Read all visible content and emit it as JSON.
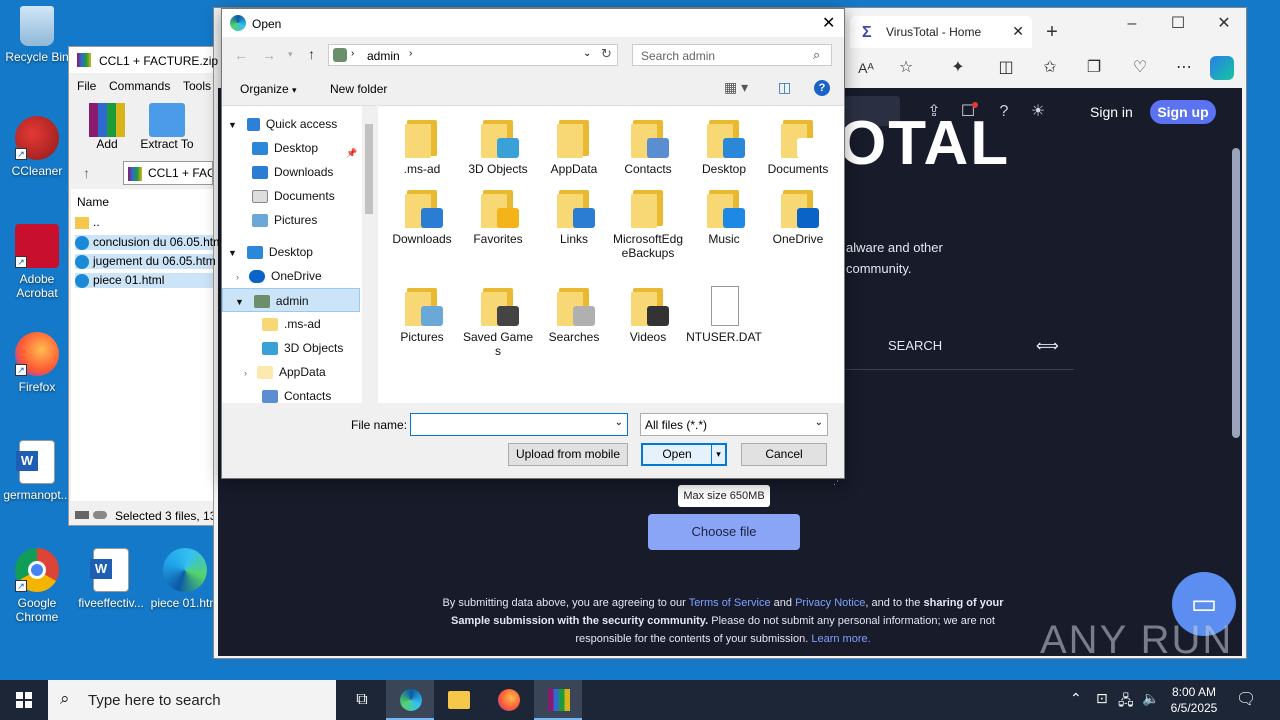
{
  "desktop": {
    "icons": [
      {
        "label": "Recycle Bin"
      },
      {
        "label": "CCleaner"
      },
      {
        "label": "Adobe Acrobat"
      },
      {
        "label": "Firefox"
      },
      {
        "label": "germanopt..."
      },
      {
        "label": "Google Chrome"
      },
      {
        "label": "fiveeffectiv..."
      },
      {
        "label": "piece 01.htm"
      }
    ]
  },
  "browser": {
    "tab_title": "VirusTotal - Home",
    "signin": "Sign in",
    "signup": "Sign up",
    "hero_partial": "OTAL",
    "desc_line1": "alware and other",
    "desc_line2": "community.",
    "search_tab": "SEARCH",
    "tooltip": "Max size 650MB",
    "choose_file": "Choose file",
    "footer": {
      "t1": "By submitting data above, you are agreeing to our ",
      "tos": "Terms of Service",
      "and": " and ",
      "privacy": "Privacy Notice",
      "t2": ", and to the ",
      "bold1": "sharing of your",
      "bold2": "Sample submission with the security community.",
      "t3": " Please do not submit any personal information; we are not",
      "t4": "responsible for the contents of your submission. ",
      "learn": "Learn more."
    },
    "watermark": "ANY RUN"
  },
  "winrar": {
    "title": "CCL1 + FACTURE.zip",
    "menu": [
      "File",
      "Commands",
      "Tools"
    ],
    "toolbar": [
      "Add",
      "Extract To"
    ],
    "path": "CCL1 + FACT",
    "col_name": "Name",
    "files": [
      "..",
      "conclusion du 06.05.htm",
      "jugement du 06.05.htm",
      "piece 01.html"
    ],
    "status": "Selected 3 files, 13,"
  },
  "dialog": {
    "title": "Open",
    "breadcrumb": "admin",
    "search_placeholder": "Search admin",
    "organize": "Organize",
    "new_folder": "New folder",
    "nav": [
      {
        "label": "Quick access"
      },
      {
        "label": "Desktop"
      },
      {
        "label": "Downloads"
      },
      {
        "label": "Documents"
      },
      {
        "label": "Pictures"
      },
      {
        "label": "Desktop"
      },
      {
        "label": "OneDrive"
      },
      {
        "label": "admin"
      },
      {
        "label": ".ms-ad"
      },
      {
        "label": "3D Objects"
      },
      {
        "label": "AppData"
      },
      {
        "label": "Contacts"
      }
    ],
    "items": [
      {
        "label": ".ms-ad",
        "badge": ""
      },
      {
        "label": "3D Objects",
        "badge": "#3aa0d8"
      },
      {
        "label": "AppData",
        "badge": ""
      },
      {
        "label": "Contacts",
        "badge": "#5a8ed0"
      },
      {
        "label": "Desktop",
        "badge": "#2b88d8"
      },
      {
        "label": "Documents",
        "badge": "#ffffff"
      },
      {
        "label": "Downloads",
        "badge": "#2b7cd3"
      },
      {
        "label": "Favorites",
        "badge": "#f2b418"
      },
      {
        "label": "Links",
        "badge": "#2b7cd3"
      },
      {
        "label": "MicrosoftEdgeBackups",
        "badge": ""
      },
      {
        "label": "Music",
        "badge": "#1e88e5"
      },
      {
        "label": "OneDrive",
        "badge": "#0a64c8"
      },
      {
        "label": "Pictures",
        "badge": "#6aa8d8"
      },
      {
        "label": "Saved Games",
        "badge": "#444444"
      },
      {
        "label": "Searches",
        "badge": "#b0b0b0"
      },
      {
        "label": "Videos",
        "badge": "#333333"
      },
      {
        "label": "NTUSER.DAT",
        "badge": "file"
      }
    ],
    "filename_label": "File name:",
    "filename_value": "",
    "filter": "All files (*.*)",
    "upload_mobile": "Upload from mobile",
    "open": "Open",
    "cancel": "Cancel"
  },
  "taskbar": {
    "search_placeholder": "Type here to search",
    "time": "8:00 AM",
    "date": "6/5/2025"
  }
}
